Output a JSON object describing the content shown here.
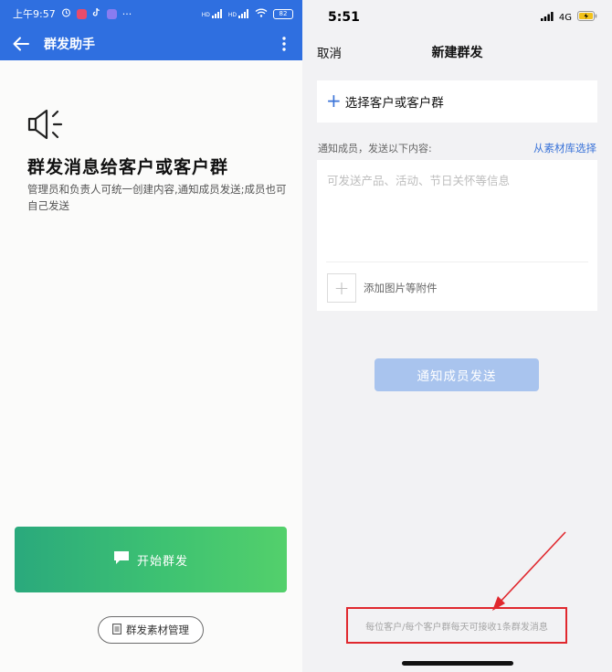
{
  "left": {
    "status_bar": {
      "time": "上午9:57",
      "icons": [
        "alarm-icon",
        "app-badge-icon",
        "tiktok-icon",
        "app-icon",
        "more-dots"
      ],
      "signal1": "HD",
      "signal2": "HD",
      "battery": "82",
      "more": "···"
    },
    "app_bar": {
      "title": "群发助手",
      "back_icon": "back-arrow-icon",
      "more_icon": "more-vertical-icon"
    },
    "hero": {
      "icon": "megaphone-icon",
      "title": "群发消息给客户或客户群",
      "description": "管理员和负责人可统一创建内容,通知成员发送;成员也可自己发送"
    },
    "start_button": {
      "label": "开始群发",
      "icon": "chat-bubble-icon"
    },
    "manage_button": {
      "label": "群发素材管理",
      "icon": "document-icon"
    }
  },
  "right": {
    "status_bar": {
      "time": "5:51",
      "network": "4G",
      "battery_icon": "battery-charging-icon"
    },
    "nav_bar": {
      "cancel": "取消",
      "title": "新建群发"
    },
    "select_customer": {
      "icon": "plus-icon",
      "label": "选择客户或客户群"
    },
    "notify": {
      "label": "通知成员，发送以下内容:",
      "from_library": "从素材库选择",
      "placeholder": "可发送产品、活动、节日关怀等信息",
      "value": ""
    },
    "attachment": {
      "label": "添加图片等附件",
      "icon": "plus-icon"
    },
    "send_button": {
      "label": "通知成员发送"
    },
    "footnote": "每位客户/每个客户群每天可接收1条群发消息",
    "colors": {
      "accent_blue": "#3a73d8",
      "left_header_blue": "#2f6fe0",
      "green_start": "#2aa97c",
      "green_end": "#53d06b",
      "send_disabled": "#a9c4ee",
      "annotation_red": "#e0282e"
    }
  }
}
